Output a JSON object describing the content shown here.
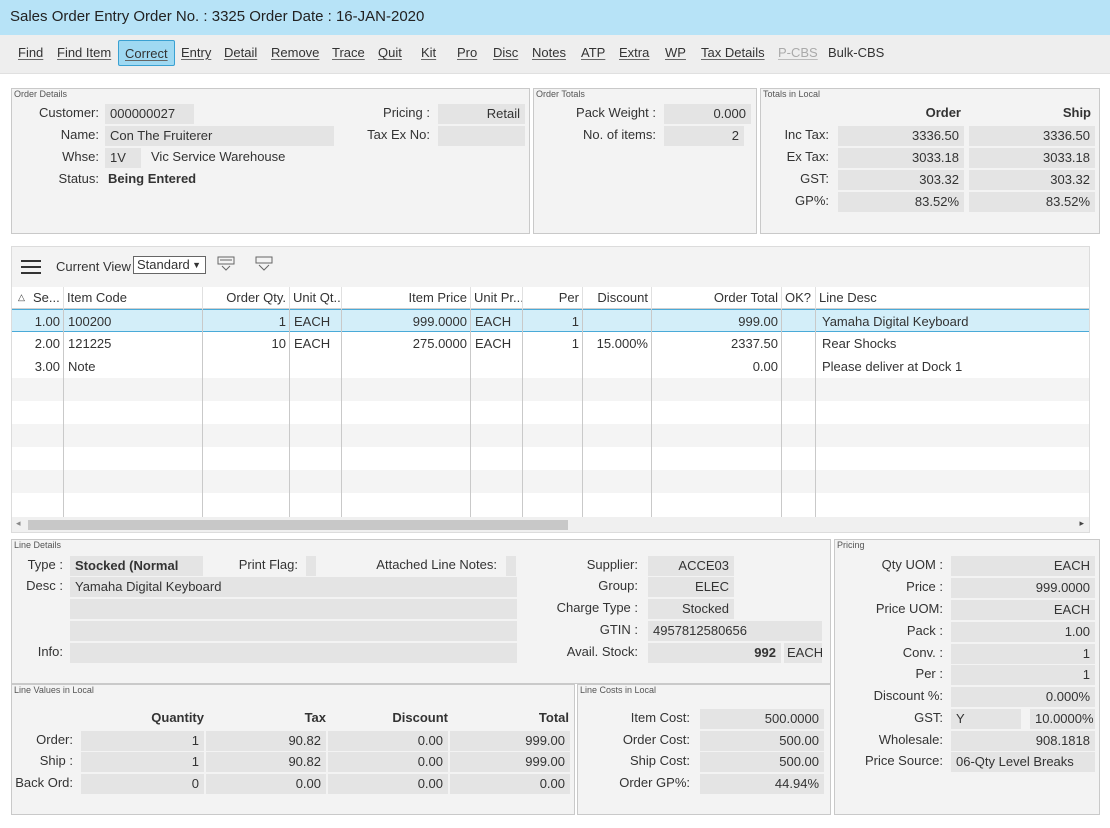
{
  "window": {
    "title": "Sales Order Entry Order No. : 3325 Order Date : 16-JAN-2020"
  },
  "toolbar": {
    "items": [
      {
        "label": "Find"
      },
      {
        "label": "Find Item"
      },
      {
        "label": "Correct"
      },
      {
        "label": "Entry"
      },
      {
        "label": "Detail"
      },
      {
        "label": "Remove"
      },
      {
        "label": "Trace"
      },
      {
        "label": "Quit"
      },
      {
        "label": "Kit"
      },
      {
        "label": "Pro"
      },
      {
        "label": "Disc"
      },
      {
        "label": "Notes"
      },
      {
        "label": "ATP"
      },
      {
        "label": "Extra"
      },
      {
        "label": "WP"
      },
      {
        "label": "Tax Details"
      },
      {
        "label": "P-CBS"
      },
      {
        "label": "Bulk-CBS"
      }
    ]
  },
  "order_details": {
    "title": "Order Details",
    "customer_label": "Customer:",
    "customer": "000000027",
    "name_label": "Name:",
    "name": "Con The Fruiterer",
    "whse_label": "Whse:",
    "whse_code": "1V",
    "whse_name": "Vic Service Warehouse",
    "status_label": "Status:",
    "status": "Being Entered",
    "pricing_label": "Pricing :",
    "pricing": "Retail",
    "taxex_label": "Tax Ex No:",
    "taxex": ""
  },
  "order_totals": {
    "title": "Order Totals",
    "pack_weight_label": "Pack Weight :",
    "pack_weight": "0.000",
    "items_label": "No. of items:",
    "items": "2"
  },
  "totals_local": {
    "title": "Totals in Local",
    "col_order": "Order",
    "col_ship": "Ship",
    "rows": [
      {
        "label": "Inc Tax:",
        "order": "3336.50",
        "ship": "3336.50"
      },
      {
        "label": "Ex Tax:",
        "order": "3033.18",
        "ship": "3033.18"
      },
      {
        "label": "GST:",
        "order": "303.32",
        "ship": "303.32"
      },
      {
        "label": "GP%:",
        "order": "83.52%",
        "ship": "83.52%"
      }
    ]
  },
  "grid": {
    "current_view_label": "Current View",
    "current_view": "Standard",
    "columns": [
      "Se...",
      "Item Code",
      "Order Qty.",
      "Unit Qt...",
      "Item Price",
      "Unit Pr...",
      "Per",
      "Discount",
      "Order Total",
      "OK?",
      "Line Desc"
    ],
    "rows": [
      [
        "1.00",
        "100200",
        "1",
        "EACH",
        "999.0000",
        "EACH",
        "1",
        "",
        "999.00",
        "",
        "Yamaha Digital Keyboard"
      ],
      [
        "2.00",
        "121225",
        "10",
        "EACH",
        "275.0000",
        "EACH",
        "1",
        "15.000%",
        "2337.50",
        "",
        "Rear Shocks"
      ],
      [
        "3.00",
        "Note",
        "",
        "",
        "",
        "",
        "",
        "",
        "0.00",
        "",
        "Please deliver at Dock 1"
      ]
    ]
  },
  "line_details": {
    "title": "Line Details",
    "type_label": "Type :",
    "type": "Stocked (Normal",
    "print_flag_label": "Print Flag:",
    "print_flag": "",
    "attached_label": "Attached Line Notes:",
    "attached": "",
    "desc_label": "Desc :",
    "desc": "Yamaha Digital Keyboard",
    "info_label": "Info:",
    "info": "",
    "supplier_label": "Supplier:",
    "supplier": "ACCE03",
    "group_label": "Group:",
    "group": "ELEC",
    "charge_label": "Charge Type :",
    "charge": "Stocked",
    "gtin_label": "GTIN :",
    "gtin": "4957812580656",
    "avail_label": "Avail. Stock:",
    "avail": "992",
    "avail_uom": "EACH"
  },
  "pricing": {
    "title": "Pricing",
    "rows": [
      {
        "label": "Qty UOM :",
        "value": "EACH"
      },
      {
        "label": "Price :",
        "value": "999.0000"
      },
      {
        "label": "Price UOM:",
        "value": "EACH"
      },
      {
        "label": "Pack :",
        "value": "1.00"
      },
      {
        "label": "Conv. :",
        "value": "1"
      },
      {
        "label": "Per :",
        "value": "1"
      },
      {
        "label": "Discount %:",
        "value": "0.000%"
      }
    ],
    "gst_label": "GST:",
    "gst_flag": "Y",
    "gst_rate": "10.0000%",
    "wholesale_label": "Wholesale:",
    "wholesale": "908.1818",
    "price_source_label": "Price Source:",
    "price_source": "06-Qty Level Breaks"
  },
  "line_values": {
    "title": "Line Values in Local",
    "cols": [
      "Quantity",
      "Tax",
      "Discount",
      "Total"
    ],
    "rows": [
      {
        "label": "Order:",
        "qty": "1",
        "tax": "90.82",
        "disc": "0.00",
        "total": "999.00"
      },
      {
        "label": "Ship :",
        "qty": "1",
        "tax": "90.82",
        "disc": "0.00",
        "total": "999.00"
      },
      {
        "label": "Back Ord:",
        "qty": "0",
        "tax": "0.00",
        "disc": "0.00",
        "total": "0.00"
      }
    ]
  },
  "line_costs": {
    "title": "Line Costs in Local",
    "rows": [
      {
        "label": "Item Cost:",
        "value": "500.0000"
      },
      {
        "label": "Order Cost:",
        "value": "500.00"
      },
      {
        "label": "Ship Cost:",
        "value": "500.00"
      },
      {
        "label": "Order GP%:",
        "value": "44.94%"
      }
    ]
  }
}
